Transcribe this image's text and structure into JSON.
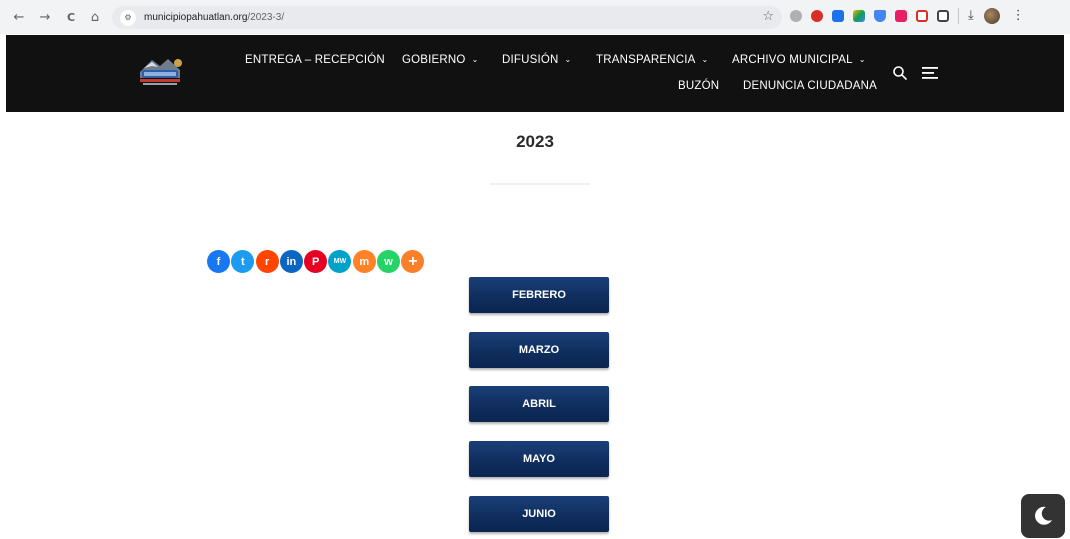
{
  "browser": {
    "url_domain": "municipiopahuatlan.org",
    "url_path": "/2023-3/",
    "nav": {
      "back": "←",
      "forward": "→",
      "reload": "C",
      "home": "⌂"
    },
    "star": "☆",
    "download": "⤓",
    "menu": "⋮",
    "extension_colors": [
      "#b0b0b0",
      "#d93025",
      "#1a73e8",
      "#f4b400",
      "#4285f4",
      "#e91e63",
      "#9e9e9e",
      "#616161"
    ]
  },
  "header": {
    "nav_items": [
      {
        "label": "ENTREGA – RECEPCIÓN",
        "caret": false
      },
      {
        "label": "GOBIERNO",
        "caret": true
      },
      {
        "label": "DIFUSIÓN",
        "caret": true
      },
      {
        "label": "TRANSPARENCIA",
        "caret": true
      },
      {
        "label": "ARCHIVO MUNICIPAL",
        "caret": true
      },
      {
        "label": "BUZÓN",
        "caret": false
      },
      {
        "label": "DENUNCIA CIUDADANA",
        "caret": false
      }
    ],
    "caret_glyph": "⌄"
  },
  "page": {
    "title": "2023"
  },
  "share": [
    {
      "network": "facebook",
      "color": "#1877f2",
      "glyph": "f"
    },
    {
      "network": "twitter",
      "color": "#1d9bf0",
      "glyph": "t"
    },
    {
      "network": "reddit",
      "color": "#ff4500",
      "glyph": "r"
    },
    {
      "network": "linkedin",
      "color": "#0a66c2",
      "glyph": "in"
    },
    {
      "network": "pinterest",
      "color": "#e60023",
      "glyph": "P"
    },
    {
      "network": "mewe",
      "color": "#00a2c9",
      "glyph": "MW"
    },
    {
      "network": "mix",
      "color": "#ff8226",
      "glyph": "m"
    },
    {
      "network": "whatsapp",
      "color": "#25d366",
      "glyph": "w"
    },
    {
      "network": "more",
      "color": "#f97f28",
      "glyph": "+"
    }
  ],
  "months": [
    {
      "label": "FEBRERO"
    },
    {
      "label": "MARZO"
    },
    {
      "label": "ABRIL"
    },
    {
      "label": "MAYO"
    },
    {
      "label": "JUNIO"
    }
  ]
}
